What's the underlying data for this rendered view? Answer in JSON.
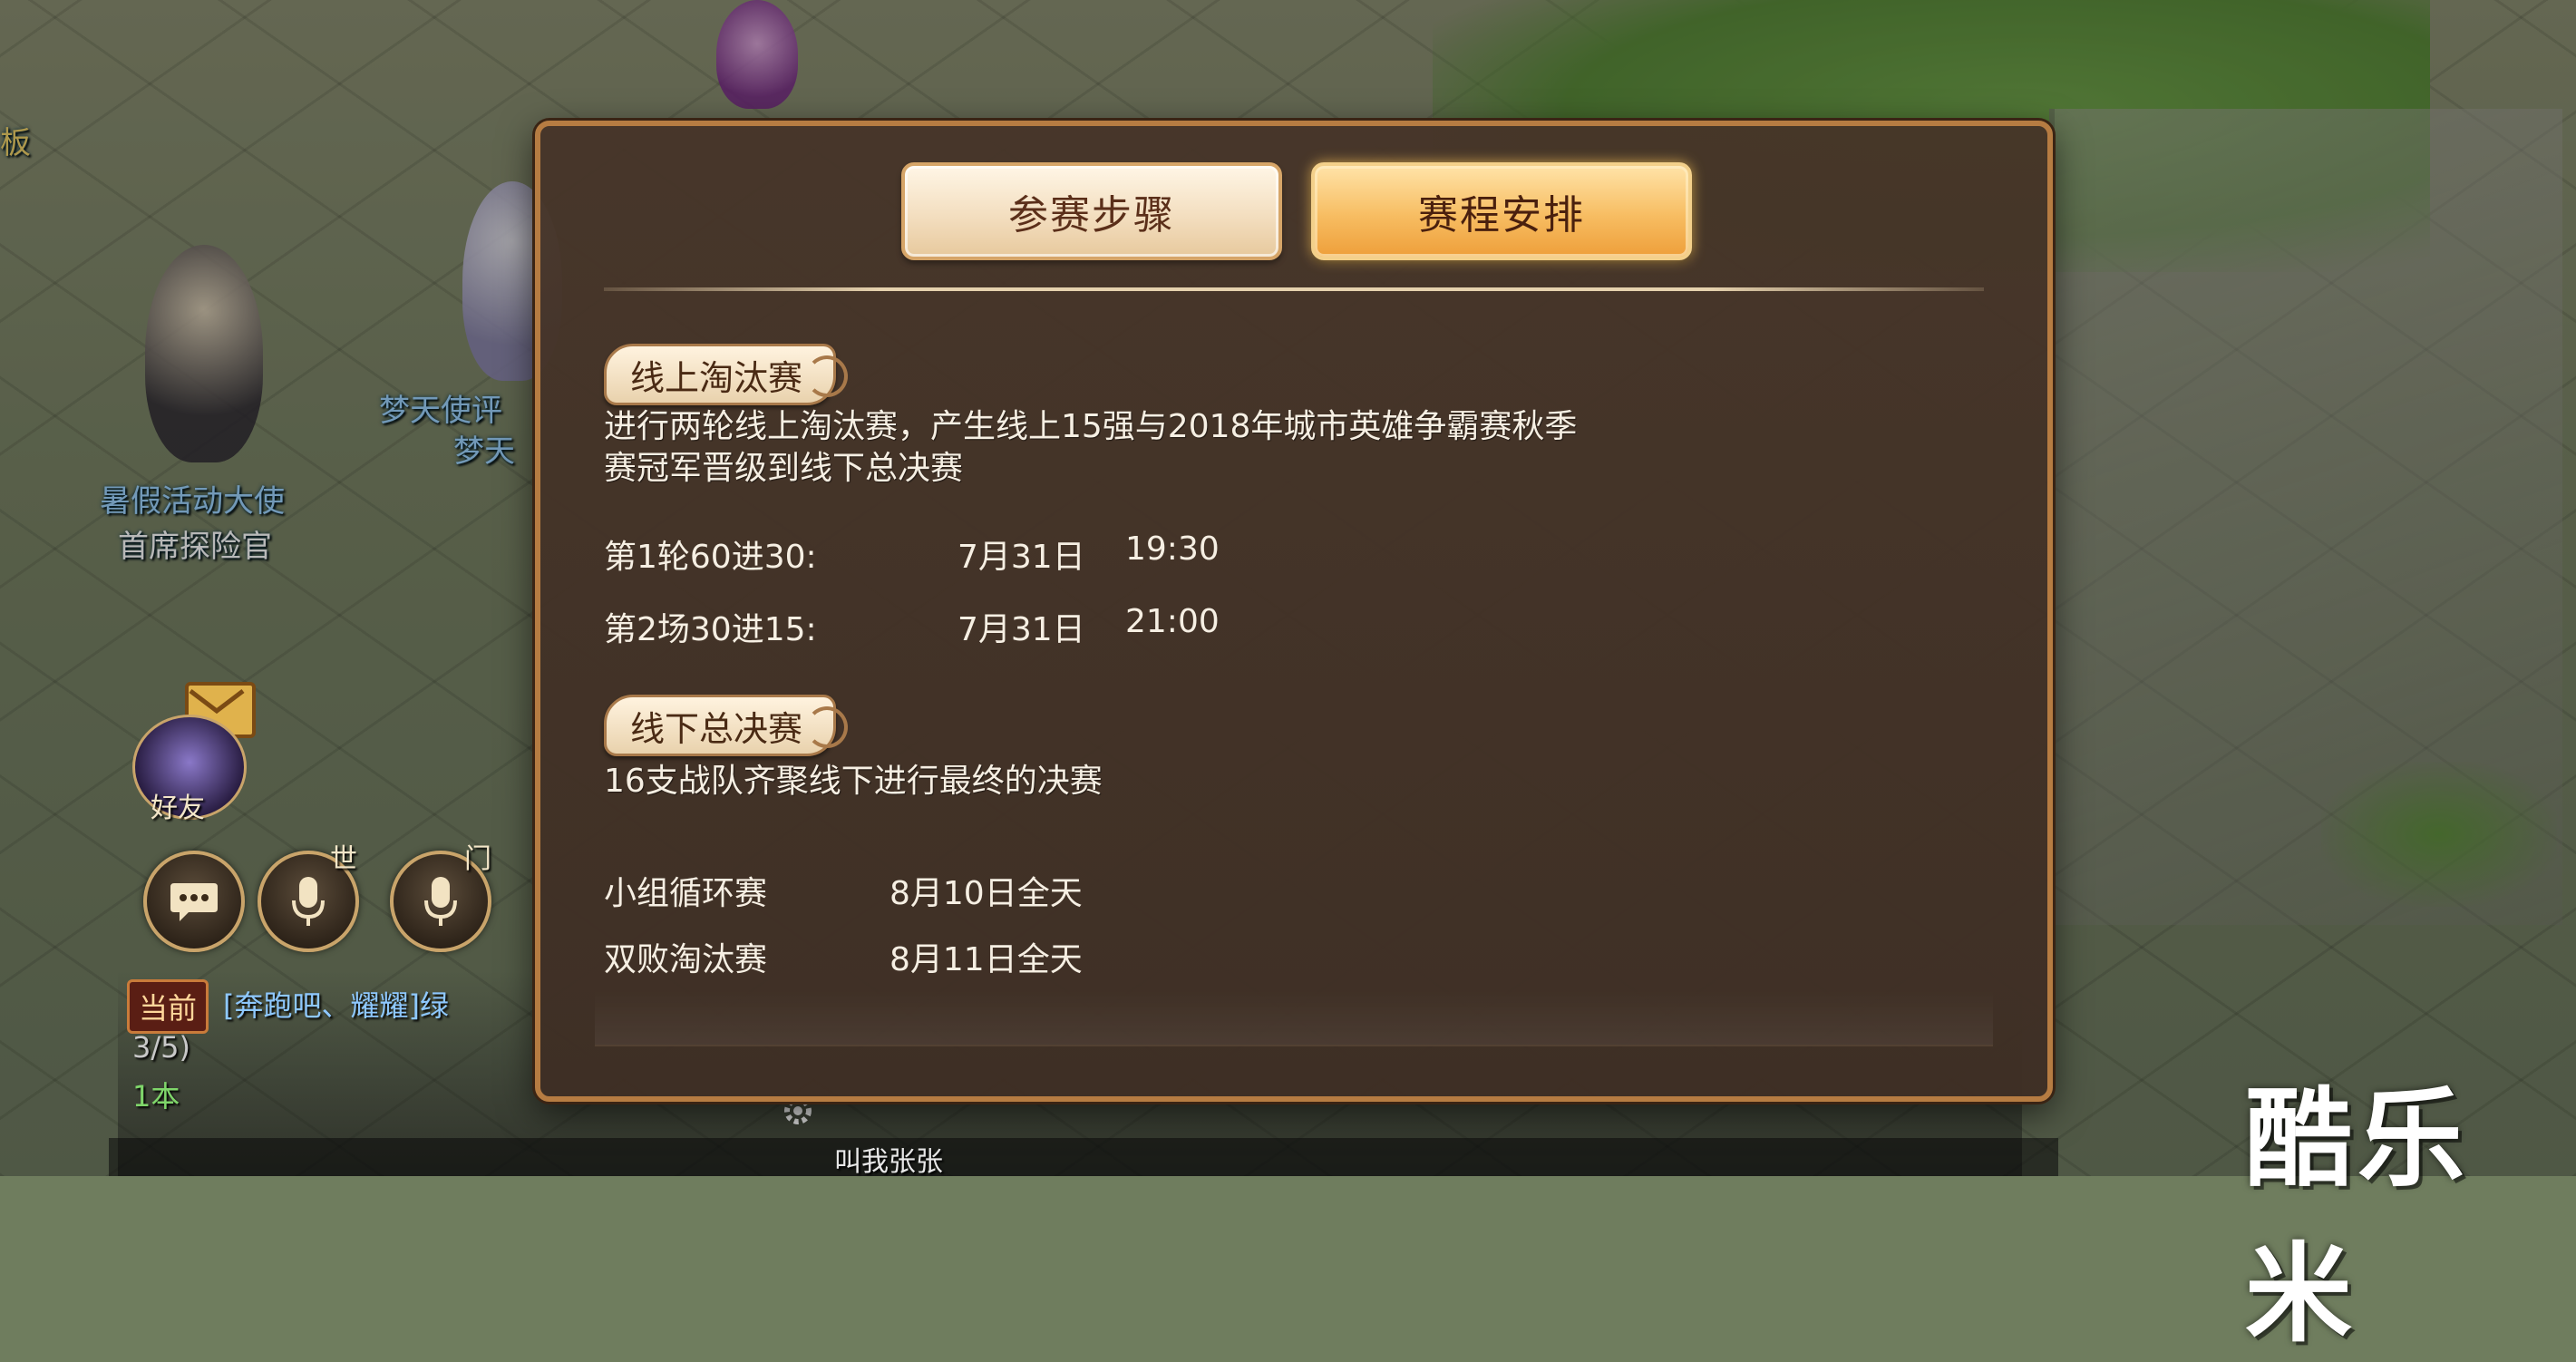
{
  "background": {
    "npcs": [
      {
        "name_line1": "暑假活动大使",
        "name_line2": "首席探险官"
      },
      {
        "name_line1": "梦天使评",
        "name_line2": "梦天"
      }
    ],
    "corner_label": "板"
  },
  "hud": {
    "friends_label": "好友",
    "world_label": "世",
    "sect_label": "门",
    "chat_channel": "当前",
    "chat_lines": [
      "[奔跑吧、耀耀]绿",
      "3/5)",
      "1本"
    ],
    "bottom_ticker": "叫我张张"
  },
  "dialog": {
    "tabs": [
      {
        "label": "参赛步骤",
        "active": false
      },
      {
        "label": "赛程安排",
        "active": true
      }
    ],
    "online": {
      "title": "线上淘汰赛",
      "desc_line1": "进行两轮线上淘汰赛，产生线上15强与2018年城市英雄争霸赛秋季",
      "desc_line2": "赛冠军晋级到线下总决赛",
      "rounds": [
        {
          "label": "第1轮60进30:",
          "date": "7月31日",
          "time": "19:30"
        },
        {
          "label": "第2场30进15:",
          "date": "7月31日",
          "time": "21:00"
        }
      ]
    },
    "offline": {
      "title": "线下总决赛",
      "desc": "16支战队齐聚线下进行最终的决赛",
      "rounds": [
        {
          "label": "小组循环赛",
          "date": "8月10日全天"
        },
        {
          "label": "双败淘汰赛",
          "date": "8月11日全天"
        }
      ]
    }
  },
  "watermark": "酷乐米",
  "colors": {
    "dialog_bg": "#46342a",
    "dialog_border": "#b67c42",
    "active_tab": "#f7bd62",
    "inactive_tab": "#f2dcbc",
    "body_text": "#f6efe3"
  }
}
